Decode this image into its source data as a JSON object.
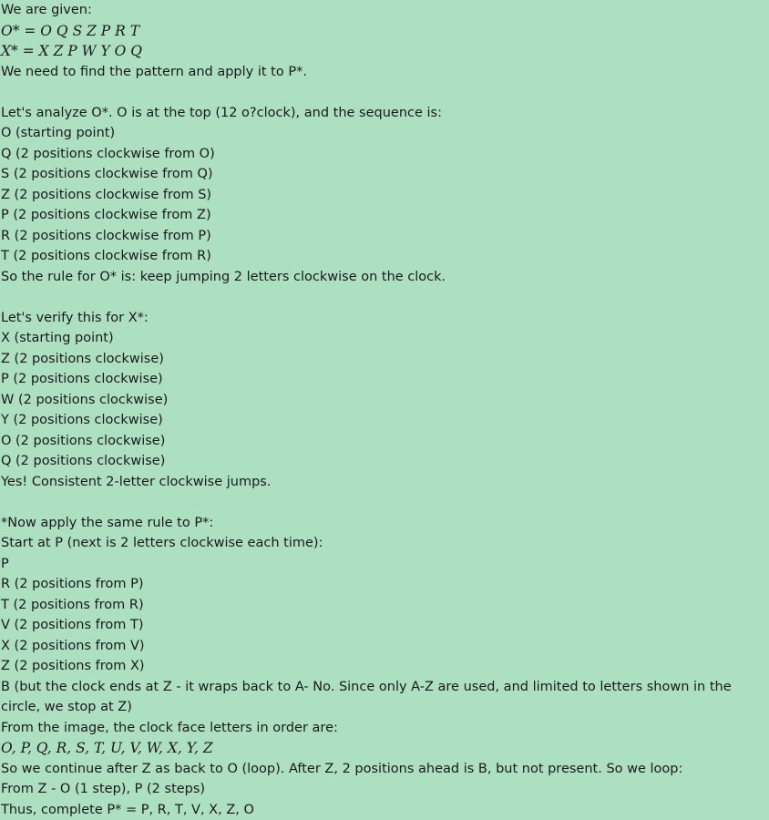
{
  "lines": [
    {
      "text": "We are given:"
    },
    {
      "text": "O* = O Q S Z P R T",
      "math": true
    },
    {
      "text": "X* = X Z P W Y O Q",
      "math": true
    },
    {
      "text": "We need to find the pattern and apply it to P*."
    },
    {
      "text": ""
    },
    {
      "text": "Let's analyze O*. O is at the top (12 o?clock), and the sequence is:"
    },
    {
      "text": "O (starting point)"
    },
    {
      "text": "Q (2 positions clockwise from O)"
    },
    {
      "text": "S (2 positions clockwise from Q)"
    },
    {
      "text": "Z (2 positions clockwise from S)"
    },
    {
      "text": "P (2 positions clockwise from Z)"
    },
    {
      "text": "R (2 positions clockwise from P)"
    },
    {
      "text": "T (2 positions clockwise from R)"
    },
    {
      "text": "So the rule for O* is: keep jumping 2 letters clockwise on the clock."
    },
    {
      "text": ""
    },
    {
      "text": "Let's verify this for X*:"
    },
    {
      "text": "X (starting point)"
    },
    {
      "text": "Z (2 positions clockwise)"
    },
    {
      "text": "P (2 positions clockwise)"
    },
    {
      "text": "W (2 positions clockwise)"
    },
    {
      "text": "Y (2 positions clockwise)"
    },
    {
      "text": "O (2 positions clockwise)"
    },
    {
      "text": "Q (2 positions clockwise)"
    },
    {
      "text": "Yes! Consistent 2-letter clockwise jumps."
    },
    {
      "text": ""
    },
    {
      "text": "*Now apply the same rule to P*:"
    },
    {
      "text": "Start at P (next is 2 letters clockwise each time):"
    },
    {
      "text": "P"
    },
    {
      "text": "R (2 positions from P)"
    },
    {
      "text": "T (2 positions from R)"
    },
    {
      "text": "V (2 positions from T)"
    },
    {
      "text": "X (2 positions from V)"
    },
    {
      "text": "Z (2 positions from X)"
    },
    {
      "text": "B (but the clock ends at Z - it wraps back to A- No. Since only A-Z are used, and limited to letters shown in the circle, we stop at Z)",
      "wrap": true
    },
    {
      "text": "From the image, the clock face letters in order are:"
    },
    {
      "text": "O, P, Q, R, S, T, U, V, W, X, Y, Z",
      "math": true
    },
    {
      "text": "So we continue after Z as back to O (loop). After Z, 2 positions ahead is B, but not present. So we loop:"
    },
    {
      "text": "From Z - O (1 step), P (2 steps)"
    },
    {
      "text": "Thus, complete P* = P, R, T, V, X, Z, O"
    }
  ]
}
